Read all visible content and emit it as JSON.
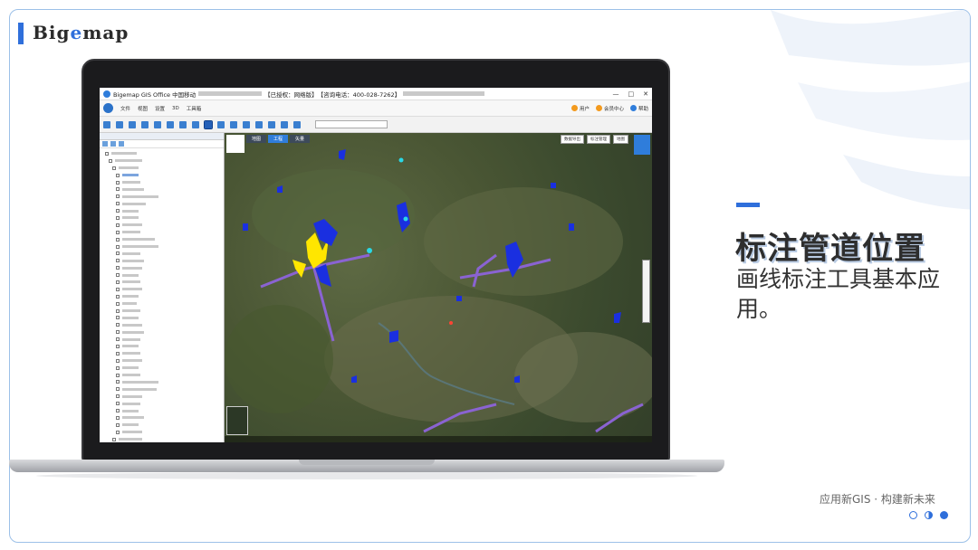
{
  "brand": {
    "prefix": "Big",
    "accent": "e",
    "suffix": "map"
  },
  "app": {
    "title_prefix": "Bigemap GIS Office 中国移动",
    "title_license": "【已授权：网络版】",
    "title_phone": "【咨询电话：400-028-7262】",
    "window_controls": [
      "—",
      "□",
      "✕"
    ],
    "menu": [
      "文件",
      "视图",
      "设置",
      "3D",
      "工具箱"
    ],
    "menu_right": [
      "用户",
      "会员中心",
      "帮助"
    ],
    "map_tabs": [
      "地图",
      "工程",
      "矢量"
    ],
    "map_controls": [
      "数据导出",
      "标注管理",
      "地图"
    ]
  },
  "slide": {
    "title": "标注管道位置",
    "description": "画线标注工具基本应用。",
    "slogan": "应用新GIS · 构建新未来"
  },
  "colors": {
    "accent": "#2f6fdb",
    "pipe_blue": "#1a2fe0",
    "pipe_yellow": "#ffe600",
    "road_purple": "#8a63d2"
  }
}
